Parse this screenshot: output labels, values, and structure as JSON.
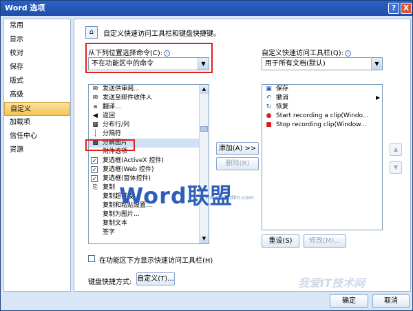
{
  "window": {
    "title": "Word 选项",
    "help": "?",
    "close": "X"
  },
  "sidebar": {
    "items": [
      {
        "label": "常用"
      },
      {
        "label": "显示"
      },
      {
        "label": "校对"
      },
      {
        "label": "保存"
      },
      {
        "label": "版式"
      },
      {
        "label": "高级"
      },
      {
        "label": "自定义",
        "active": true
      },
      {
        "label": "加载项"
      },
      {
        "label": "信任中心"
      },
      {
        "label": "资源"
      }
    ]
  },
  "header": {
    "text": "自定义快速访问工具栏和键盘快捷键。"
  },
  "left": {
    "choose_label": "从下列位置选择命令(C):",
    "choose_value": "不在功能区中的命令",
    "items": [
      {
        "label": "发送供审阅...",
        "icon": "✉"
      },
      {
        "label": "发送至邮件收件人",
        "icon": "✉"
      },
      {
        "label": "翻译...",
        "icon": "a"
      },
      {
        "label": "返回",
        "icon": "◀"
      },
      {
        "label": "分布行/列",
        "icon": "▦"
      },
      {
        "label": "分隔符",
        "icon": "┊"
      },
      {
        "label": "分解图片",
        "icon": "▩",
        "selected": true
      },
      {
        "label": "附件选项",
        "icon": ""
      },
      {
        "label": "复选框(ActiveX 控件)",
        "icon": "✓",
        "checkbox": true
      },
      {
        "label": "复选框(Web 控件)",
        "icon": "✓",
        "checkbox": true
      },
      {
        "label": "复选框(窗体控件)",
        "icon": "✓",
        "checkbox": true
      },
      {
        "label": "复制",
        "icon": "⎘"
      },
      {
        "label": "复制超链接",
        "icon": ""
      },
      {
        "label": "复制和粘贴设置...",
        "icon": ""
      },
      {
        "label": "复制为图片...",
        "icon": ""
      },
      {
        "label": "复制文本",
        "icon": ""
      },
      {
        "label": "签字",
        "icon": ""
      }
    ]
  },
  "right": {
    "customize_label": "自定义快速访问工具栏(Q):",
    "customize_value": "用于所有文档(默认)",
    "items": [
      {
        "label": "保存",
        "icon": "▣"
      },
      {
        "label": "撤消",
        "icon": "↶"
      },
      {
        "label": "恢复",
        "icon": "↻"
      },
      {
        "label": "Start recording a clip(Windo...",
        "icon": "●"
      },
      {
        "label": "Stop recording clip(Window...",
        "icon": "■"
      }
    ],
    "reset_label": "重设(S)",
    "modify_label": "修改(M)..."
  },
  "buttons": {
    "add": "添加(A) >>",
    "remove": "删除(R)",
    "ok": "确定",
    "cancel": "取消",
    "customize_keyboard": "自定义(T)..."
  },
  "show_below_label": "在功能区下方显示快速访问工具栏(H)",
  "keyboard_label": "键盘快捷方式:",
  "watermark": {
    "url": "www.wordlm.com",
    "text": "Word联盟",
    "text2": "我爱IT技术网"
  }
}
